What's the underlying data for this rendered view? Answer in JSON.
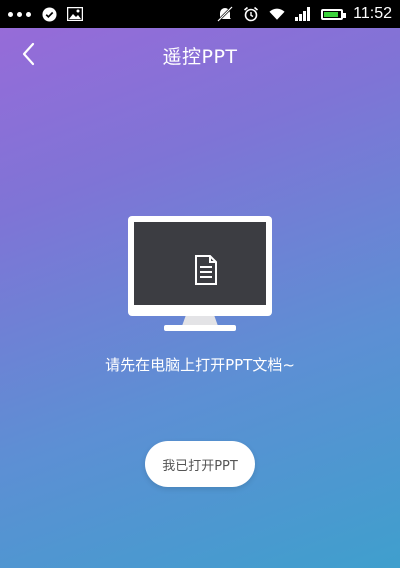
{
  "status_bar": {
    "time": "11:52",
    "icons_left": [
      "more-dots-icon",
      "check-circle-icon",
      "image-icon"
    ],
    "icons_right": [
      "mute-icon",
      "alarm-icon",
      "wifi-icon",
      "signal-icon",
      "battery-icon"
    ],
    "battery_color": "#3bd13b"
  },
  "header": {
    "title": "遥控PPT",
    "back_icon": "chevron-left-icon"
  },
  "illustration": {
    "icon": "document-icon",
    "screen_color": "#3c3d42"
  },
  "hint": "请先在电脑上打开PPT文档~",
  "confirm_button": {
    "label": "我已打开PPT"
  },
  "colors": {
    "gradient_top": "#9a6ad9",
    "gradient_bottom": "#3f9fcd"
  }
}
